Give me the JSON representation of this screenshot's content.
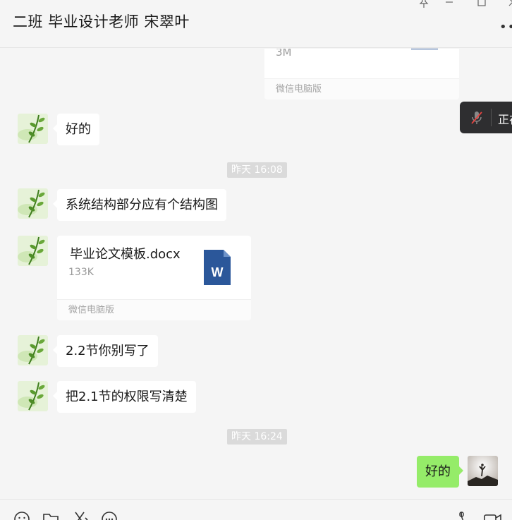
{
  "header": {
    "title": "二班 毕业设计老师 宋翠叶",
    "more_label": "•••"
  },
  "voice_float": {
    "text": "正在"
  },
  "messages": {
    "prev_file": {
      "size": "3M",
      "source": "微信电脑版"
    },
    "msg1": {
      "text": "好的"
    },
    "time1": "昨天 16:08",
    "msg2": {
      "text": "系统结构部分应有个结构图"
    },
    "file": {
      "name": "毕业论文模板.docx",
      "size": "133K",
      "source": "微信电脑版"
    },
    "msg3": {
      "text": "2.2节你别写了"
    },
    "msg4": {
      "text": "把2.1节的权限写清楚"
    },
    "time2": "昨天 16:24",
    "msg5": {
      "text": "好的"
    }
  },
  "icons": {
    "pin": "pin-icon",
    "minimize": "minimize-icon",
    "maximize": "maximize-icon",
    "close": "close-icon",
    "word": "word-file-icon",
    "mic_muted": "mic-muted-icon",
    "emoji": "emoji-icon",
    "folder": "folder-icon",
    "scissors": "scissors-icon",
    "chat": "chat-bubble-icon",
    "phone": "phone-icon",
    "video": "video-call-icon"
  },
  "colors": {
    "outgoing_bubble": "#95ec69",
    "incoming_bubble": "#ffffff",
    "word_blue": "#2b579a"
  }
}
